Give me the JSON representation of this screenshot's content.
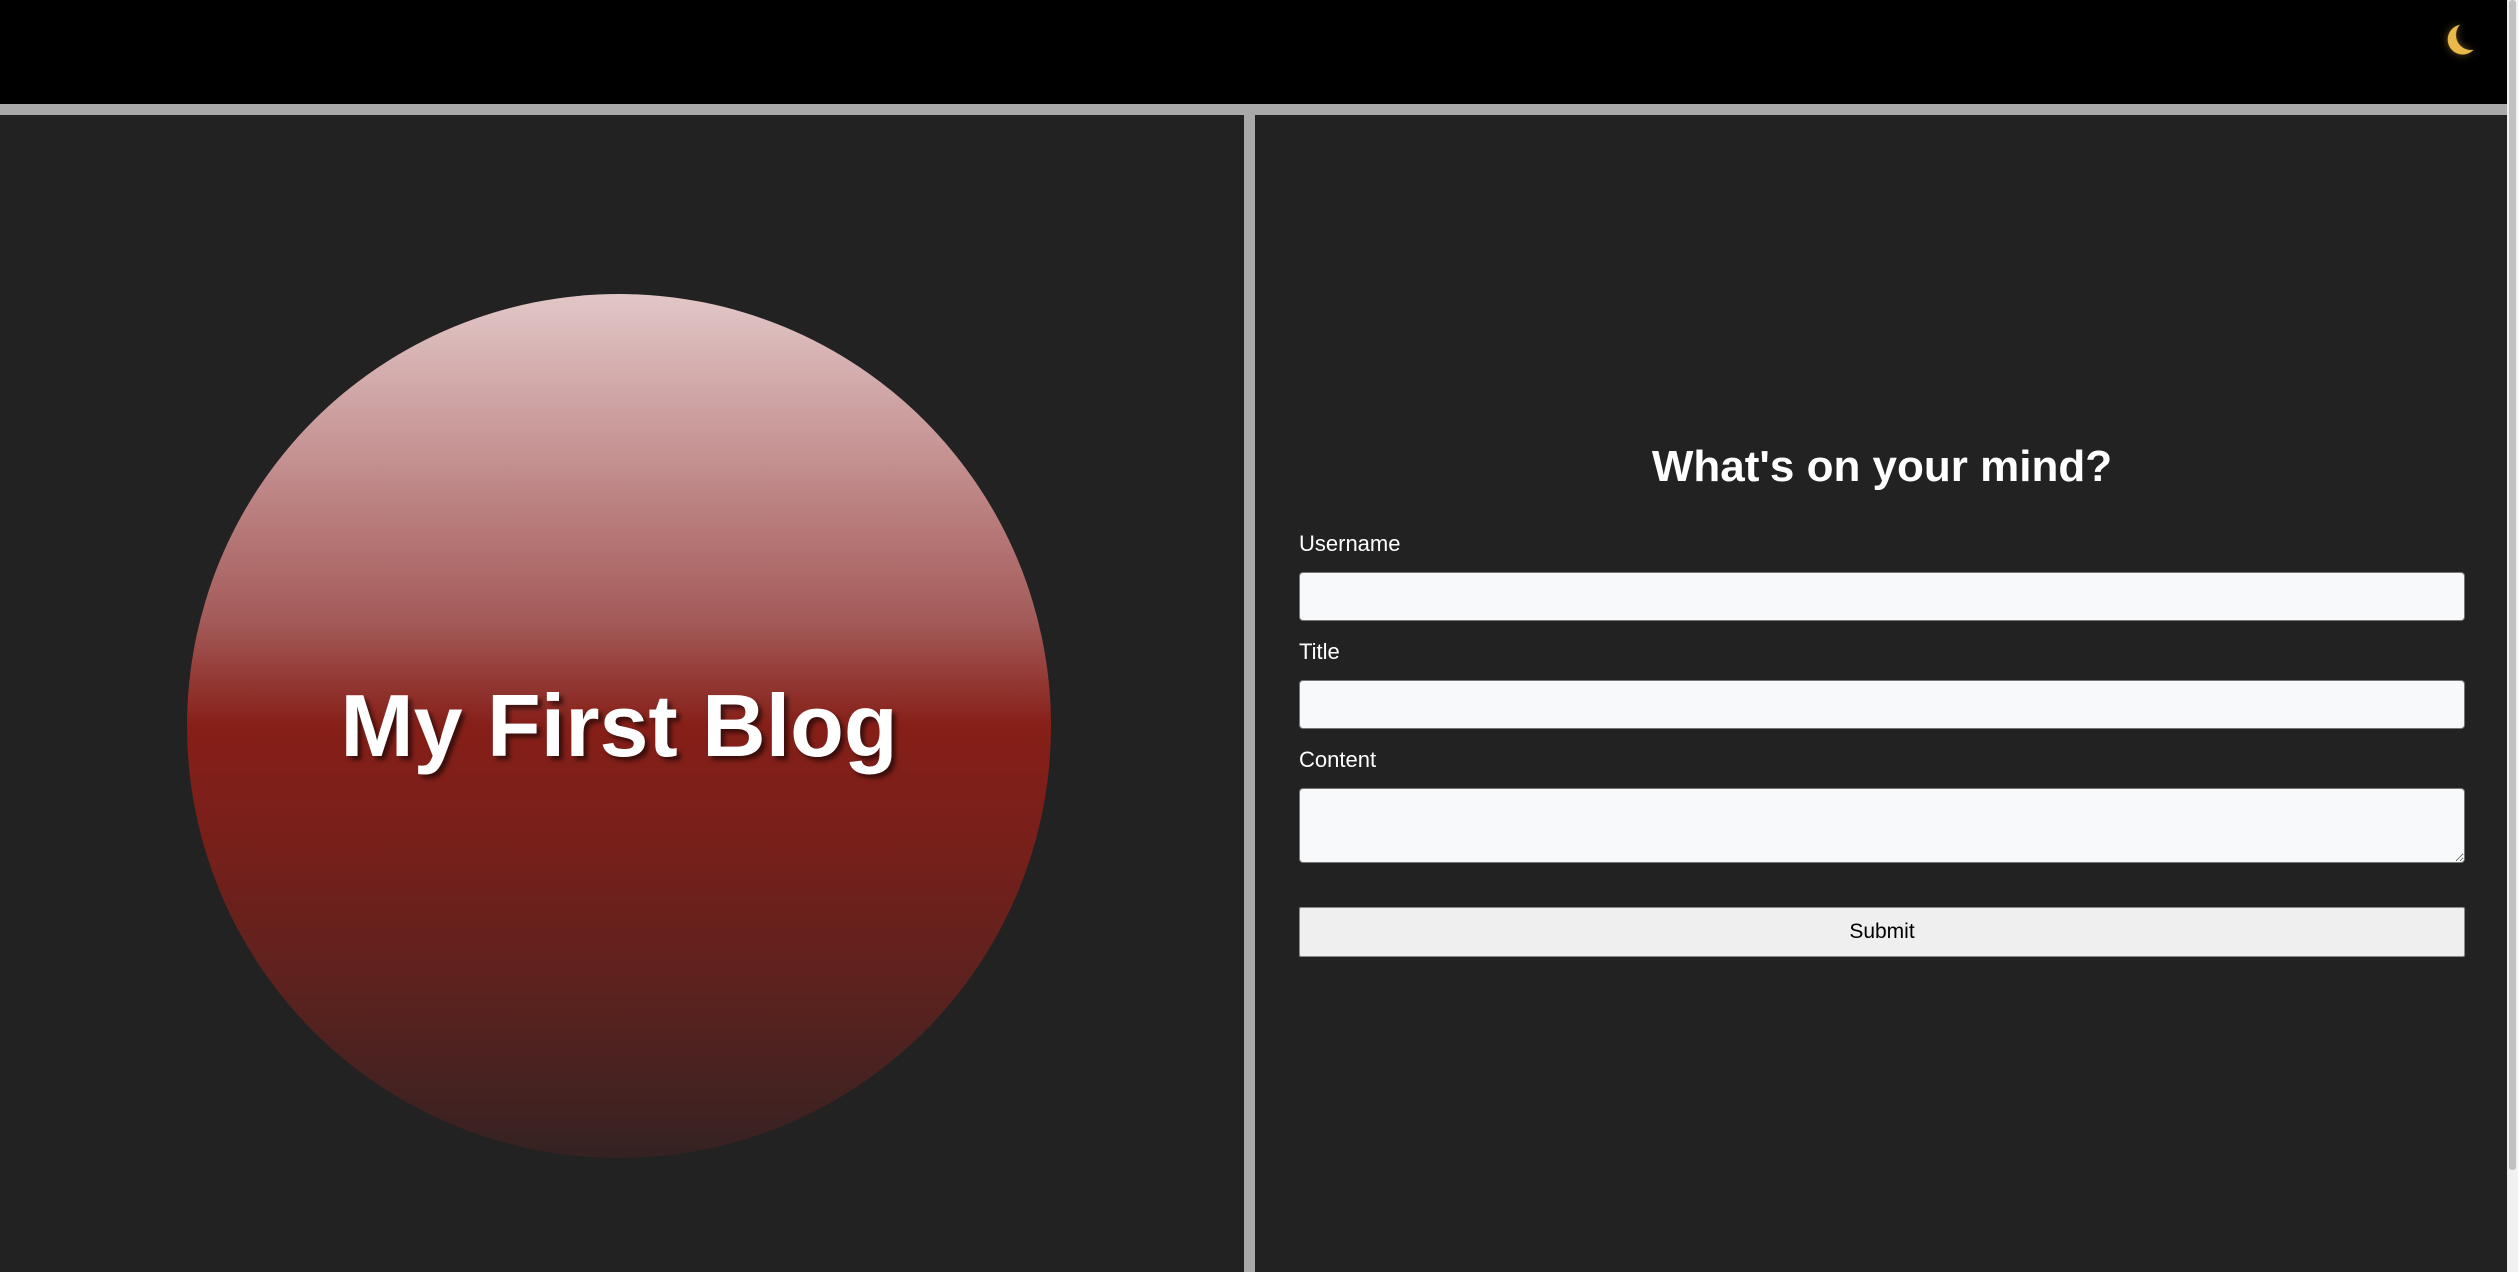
{
  "header": {
    "theme_toggle_icon": "moon-icon",
    "theme_toggle_glyph": "🌙"
  },
  "hero": {
    "title": "My First Blog"
  },
  "form": {
    "heading": "What's on your mind?",
    "username_label": "Username",
    "username_value": "",
    "title_label": "Title",
    "title_value": "",
    "content_label": "Content",
    "content_value": "",
    "submit_label": "Submit"
  },
  "colors": {
    "background": "#222222",
    "topbar": "#000000",
    "divider": "#a9a9a9",
    "accent_red": "#861f18",
    "moon": "#e9b949"
  }
}
